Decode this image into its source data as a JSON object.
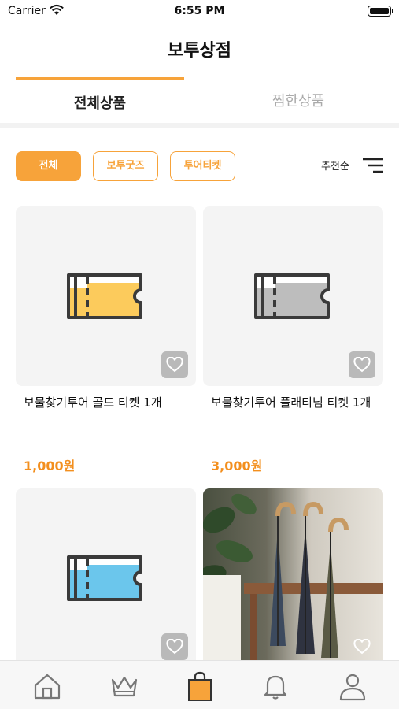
{
  "status": {
    "carrier": "Carrier",
    "time": "6:55 PM"
  },
  "header": {
    "title": "보투상점"
  },
  "tabs": [
    {
      "label": "전체상품"
    },
    {
      "label": "찜한상품"
    }
  ],
  "filters": [
    {
      "label": "전체"
    },
    {
      "label": "보투굿즈"
    },
    {
      "label": "투어티켓"
    }
  ],
  "sort": {
    "label": "추천순"
  },
  "colors": {
    "accent": "#F7A33A",
    "price": "#F38F1E",
    "gold": "#FCCB5C",
    "platinum": "#BDBDBD",
    "blue": "#6BC6EC"
  },
  "products": [
    {
      "name": "보물찾기투어 골드 티켓 1개",
      "price": "1,000원",
      "icon": "gold-ticket-icon"
    },
    {
      "name": "보물찾기투어 플래티넘 티켓 1개",
      "price": "3,000원",
      "icon": "platinum-ticket-icon"
    },
    {
      "name": "",
      "price": "",
      "icon": "blue-ticket-icon"
    },
    {
      "name": "",
      "price": "",
      "icon": "umbrella-photo"
    }
  ],
  "bottom_nav": [
    {
      "icon": "home-icon"
    },
    {
      "icon": "crown-icon"
    },
    {
      "icon": "shopping-bag-icon",
      "active": true
    },
    {
      "icon": "bell-icon"
    },
    {
      "icon": "profile-icon"
    }
  ]
}
